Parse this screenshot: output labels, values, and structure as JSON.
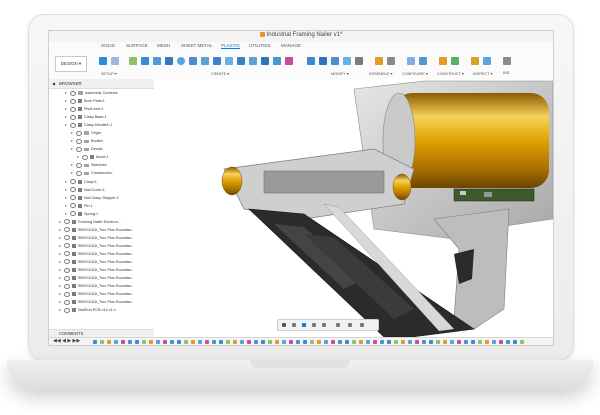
{
  "window": {
    "title": "Industrial Framing Nailer v1*"
  },
  "tabs": [
    {
      "label": "SOLID",
      "active": false
    },
    {
      "label": "SURFACE",
      "active": false
    },
    {
      "label": "MESH",
      "active": false
    },
    {
      "label": "SHEET METAL",
      "active": false
    },
    {
      "label": "PLASTIC",
      "active": true
    },
    {
      "label": "UTILITIES",
      "active": false
    },
    {
      "label": "MANAGE",
      "active": false
    }
  ],
  "toolbar": {
    "design_label": "DESIGN ▾",
    "groups": [
      "SETUP ▾",
      "CREATE ▾",
      "MODIFY ▾",
      "ASSEMBLE ▾",
      "CONFIGURE ▾",
      "CONSTRUCT ▾",
      "INSPECT ▾",
      "INS"
    ]
  },
  "browser": {
    "title": "BROWSER",
    "items": [
      {
        "label": "Assembly Contexts",
        "depth": 2,
        "type": "folder"
      },
      {
        "label": "Bore Plate:1",
        "depth": 2,
        "type": "comp"
      },
      {
        "label": "Pivot Arm:1",
        "depth": 2,
        "type": "comp"
      },
      {
        "label": "Clasp Base:1",
        "depth": 2,
        "type": "comp"
      },
      {
        "label": "Clasp Handle1:1",
        "depth": 2,
        "type": "comp"
      },
      {
        "label": "Origin",
        "depth": 3,
        "type": "folder"
      },
      {
        "label": "Bodies",
        "depth": 3,
        "type": "folder"
      },
      {
        "label": "Decals",
        "depth": 3,
        "type": "folder"
      },
      {
        "label": "Accel:1",
        "depth": 4,
        "type": "comp"
      },
      {
        "label": "Sketches",
        "depth": 3,
        "type": "folder"
      },
      {
        "label": "Construction",
        "depth": 3,
        "type": "folder"
      },
      {
        "label": "Clasp:1",
        "depth": 2,
        "type": "comp"
      },
      {
        "label": "Nail Cover:1",
        "depth": 2,
        "type": "comp"
      },
      {
        "label": "Nail Clasp Stopper:1",
        "depth": 2,
        "type": "comp"
      },
      {
        "label": "Pin:1",
        "depth": 2,
        "type": "comp"
      },
      {
        "label": "Spring:1",
        "depth": 2,
        "type": "comp"
      },
      {
        "label": "Framing Nailer Electron...",
        "depth": 1,
        "type": "comp"
      },
      {
        "label": "95597A116_Torx Plus Roundво...",
        "depth": 1,
        "type": "comp"
      },
      {
        "label": "95597A116_Torx Plus Roundво...",
        "depth": 1,
        "type": "comp"
      },
      {
        "label": "95597A116_Torx Plus Roundво...",
        "depth": 1,
        "type": "comp"
      },
      {
        "label": "95597A116_Torx Plus Roundво...",
        "depth": 1,
        "type": "comp"
      },
      {
        "label": "95597A116_Torx Plus Roundво...",
        "depth": 1,
        "type": "comp"
      },
      {
        "label": "95597A116_Torx Plus Roundво...",
        "depth": 1,
        "type": "comp"
      },
      {
        "label": "95597A116_Torx Plus Roundво...",
        "depth": 1,
        "type": "comp"
      },
      {
        "label": "95597A116_Torx Plus Roundво...",
        "depth": 1,
        "type": "comp"
      },
      {
        "label": "95597A116_Torx Plus Roundво...",
        "depth": 1,
        "type": "comp"
      },
      {
        "label": "95597A116_Torx Plus Roundво...",
        "depth": 1,
        "type": "comp"
      },
      {
        "label": "NailGun.PCB v14 v1:1",
        "depth": 1,
        "type": "comp"
      }
    ]
  },
  "comments": {
    "label": "COMMENTS"
  },
  "colors": {
    "accent": "#0a7bd8",
    "gold": "#e0a200",
    "dark_frame": "#2b2b2b"
  }
}
